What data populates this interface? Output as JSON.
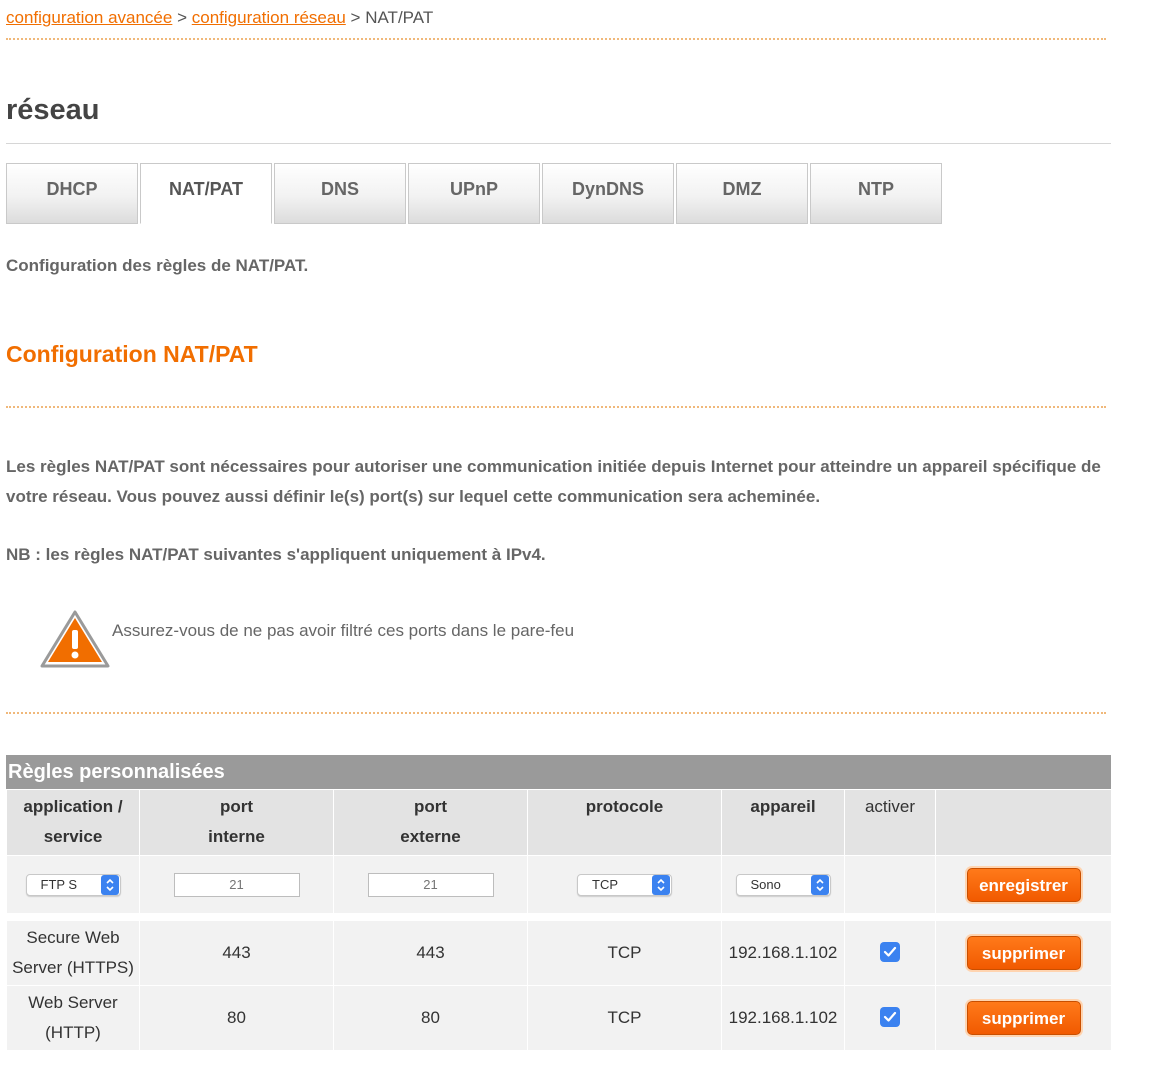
{
  "breadcrumb": {
    "link1": "configuration avancée",
    "sep1": ">",
    "link2": "configuration réseau",
    "sep2": ">",
    "current": "NAT/PAT"
  },
  "page_title": "réseau",
  "tabs": [
    {
      "label": "DHCP"
    },
    {
      "label": "NAT/PAT",
      "active": true
    },
    {
      "label": "DNS"
    },
    {
      "label": "UPnP"
    },
    {
      "label": "DynDNS"
    },
    {
      "label": "DMZ"
    },
    {
      "label": "NTP"
    }
  ],
  "intro": "Configuration des règles de NAT/PAT.",
  "section_title": "Configuration NAT/PAT",
  "description": "Les règles NAT/PAT sont nécessaires pour autoriser une communication initiée depuis Internet pour atteindre un appareil spécifique de votre réseau. Vous pouvez aussi définir le(s) port(s) sur lequel cette communication sera acheminée.",
  "note": "NB : les règles NAT/PAT suivantes s'appliquent uniquement à IPv4.",
  "warning": {
    "icon": "warning-triangle-icon",
    "text": "Assurez-vous de ne pas avoir filtré ces ports dans le pare-feu"
  },
  "rules": {
    "title": "Règles personnalisées",
    "columns": {
      "application": [
        "application /",
        "service"
      ],
      "port_interne": [
        "port",
        "interne"
      ],
      "port_externe": [
        "port",
        "externe"
      ],
      "protocole": "protocole",
      "appareil": "appareil",
      "activer": "activer"
    },
    "form": {
      "application_value": "FTP S",
      "port_interne_placeholder": "21",
      "port_externe_placeholder": "21",
      "protocole_value": "TCP",
      "appareil_value": "Sono",
      "save_label": "enregistrer"
    },
    "rows": [
      {
        "application": [
          "Secure Web",
          "Server (HTTPS)"
        ],
        "port_interne": "443",
        "port_externe": "443",
        "protocole": "TCP",
        "appareil": "192.168.1.102",
        "activer": true,
        "delete_label": "supprimer"
      },
      {
        "application": [
          "Web Server",
          "(HTTP)"
        ],
        "port_interne": "80",
        "port_externe": "80",
        "protocole": "TCP",
        "appareil": "192.168.1.102",
        "activer": true,
        "delete_label": "supprimer"
      }
    ]
  },
  "colors": {
    "accent": "#f16e00",
    "header_gray": "#9a9a9a",
    "checkbox_blue": "#3b82f0"
  }
}
